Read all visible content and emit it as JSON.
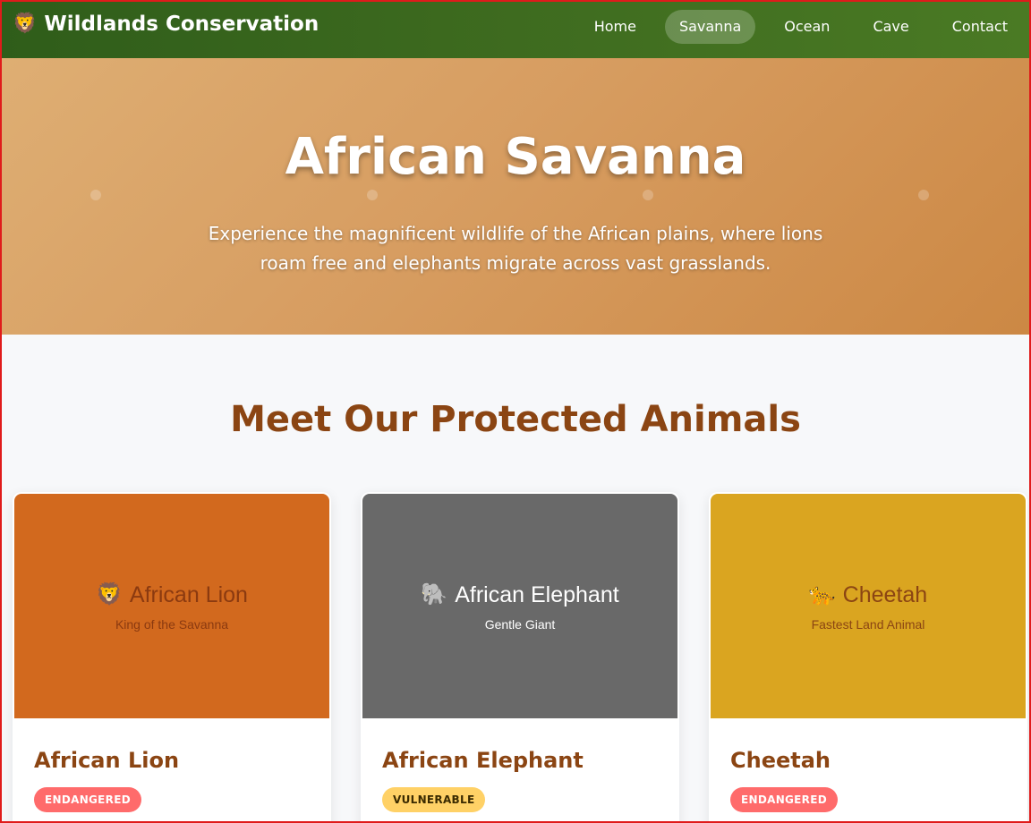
{
  "nav": {
    "brand": "Wildlands Conservation",
    "brand_icon": "🦁",
    "links": [
      {
        "label": "Home",
        "active": false
      },
      {
        "label": "Savanna",
        "active": true
      },
      {
        "label": "Ocean",
        "active": false
      },
      {
        "label": "Cave",
        "active": false
      },
      {
        "label": "Contact",
        "active": false
      }
    ]
  },
  "hero": {
    "title": "African Savanna",
    "subtitle": "Experience the magnificent wildlife of the African plains, where lions roam free and elephants migrate across vast grasslands."
  },
  "section": {
    "title": "Meet Our Protected Animals"
  },
  "cards": [
    {
      "emoji": "🦁",
      "media_title": "African Lion",
      "media_subtitle": "King of the Savanna",
      "media_color": "#d2691e",
      "media_text_color": "#8b3a10",
      "name": "African Lion",
      "status": "ENDANGERED",
      "status_bg": "#ff6b6b",
      "status_fg": "#ffffff"
    },
    {
      "emoji": "🐘",
      "media_title": "African Elephant",
      "media_subtitle": "Gentle Giant",
      "media_color": "#696969",
      "media_text_color": "#ffffff",
      "name": "African Elephant",
      "status": "VULNERABLE",
      "status_bg": "#ffd166",
      "status_fg": "#3a2a00"
    },
    {
      "emoji": "🐆",
      "media_title": "Cheetah",
      "media_subtitle": "Fastest Land Animal",
      "media_color": "#daa520",
      "media_text_color": "#8b4513",
      "name": "Cheetah",
      "status": "ENDANGERED",
      "status_bg": "#ff6b6b",
      "status_fg": "#ffffff"
    }
  ]
}
